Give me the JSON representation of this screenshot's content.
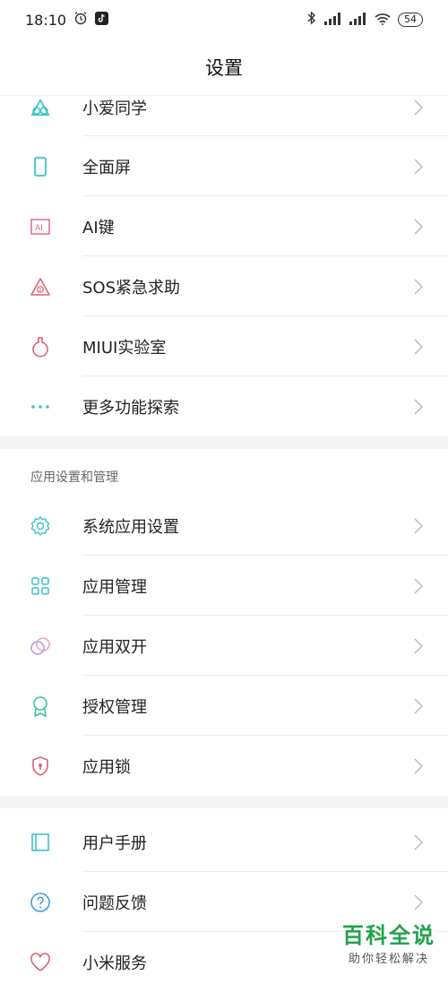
{
  "status": {
    "time": "18:10",
    "battery": "54"
  },
  "header": {
    "title": "设置"
  },
  "group1": [
    {
      "label": "小爱同学",
      "icon": "xiaoai-icon"
    },
    {
      "label": "全面屏",
      "icon": "fullscreen-icon"
    },
    {
      "label": "AI键",
      "icon": "ai-key-icon"
    },
    {
      "label": "SOS紧急求助",
      "icon": "sos-icon"
    },
    {
      "label": "MIUI实验室",
      "icon": "lab-flask-icon"
    },
    {
      "label": "更多功能探索",
      "icon": "more-dots-icon"
    }
  ],
  "group2": {
    "header": "应用设置和管理",
    "items": [
      {
        "label": "系统应用设置",
        "icon": "gear-icon"
      },
      {
        "label": "应用管理",
        "icon": "apps-grid-icon"
      },
      {
        "label": "应用双开",
        "icon": "dual-apps-icon"
      },
      {
        "label": "授权管理",
        "icon": "permission-badge-icon"
      },
      {
        "label": "应用锁",
        "icon": "app-lock-icon"
      }
    ]
  },
  "group3": [
    {
      "label": "用户手册",
      "icon": "manual-icon"
    },
    {
      "label": "问题反馈",
      "icon": "feedback-icon"
    },
    {
      "label": "小米服务",
      "icon": "heart-icon"
    }
  ],
  "watermark": {
    "title": "百科全说",
    "subtitle": "助你轻松解决"
  },
  "colors": {
    "teal": "#3cc3c9",
    "pink": "#e0607a",
    "purple": "#b39ddb",
    "section_bg": "#f5f5f5"
  }
}
